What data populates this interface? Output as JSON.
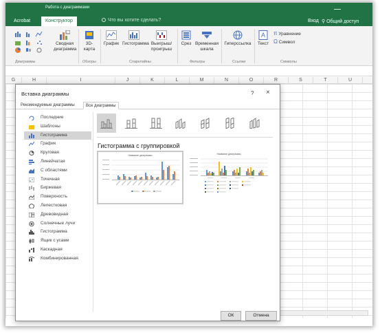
{
  "window": {
    "context_title": "Работа с диаграммами"
  },
  "ribbon_tabs": [
    "Acrobat",
    "Конструктор"
  ],
  "tell_me": "Что вы хотите сделать?",
  "account": {
    "signin": "Вход",
    "share": "Общий доступ"
  },
  "ribbon": {
    "items": {
      "summary": "Сводная диаграмма",
      "map3d": "3D-карта",
      "graph": "График",
      "histogram": "Гистограмма",
      "winloss": "Выигрыш/ проигрыш",
      "slicer": "Срез",
      "timeline": "Временная шкала",
      "hyperlink": "Гиперссылка",
      "text": "Текст",
      "equation": "Уравнение",
      "symbol": "Символ"
    },
    "groups": {
      "charts": "Диаграммы",
      "tours": "Обзоры",
      "sparklines": "Спарклайны",
      "filters": "Фильтры",
      "links": "Ссылки",
      "symbols": "Символы"
    }
  },
  "sheet": {
    "columns": [
      "G",
      "H",
      "I",
      "J",
      "K",
      "L",
      "M",
      "N",
      "O",
      "R",
      "S",
      "T",
      "U"
    ]
  },
  "dialog": {
    "title": "Вставка диаграммы",
    "help": "?",
    "close": "×",
    "tabs": [
      "Рекомендуемые диаграммы",
      "Все диаграммы"
    ],
    "chart_types": [
      "Последние",
      "Шаблоны",
      "Гистограмма",
      "График",
      "Круговая",
      "Линейчатая",
      "С областями",
      "Точечная",
      "Биржевая",
      "Поверхность",
      "Лепестковая",
      "Древовидная",
      "Солнечные лучи",
      "Гистограмма",
      "Ящик с усами",
      "Каскадная",
      "Комбинированная"
    ],
    "selected_type_index": 2,
    "subtype_heading": "Гистограмма с группировкой",
    "preview_titles": [
      "Название диаграммы",
      "Название диаграммы"
    ],
    "ok": "ОК",
    "cancel": "Отмена"
  },
  "colors": {
    "excel_green": "#217346",
    "series_blue": "#5b9bd5",
    "series_orange": "#ed7d31",
    "series_gray": "#a5a5a5",
    "series_gold": "#ffc000",
    "series_darkblue": "#4472c4",
    "series_green": "#70ad47"
  }
}
